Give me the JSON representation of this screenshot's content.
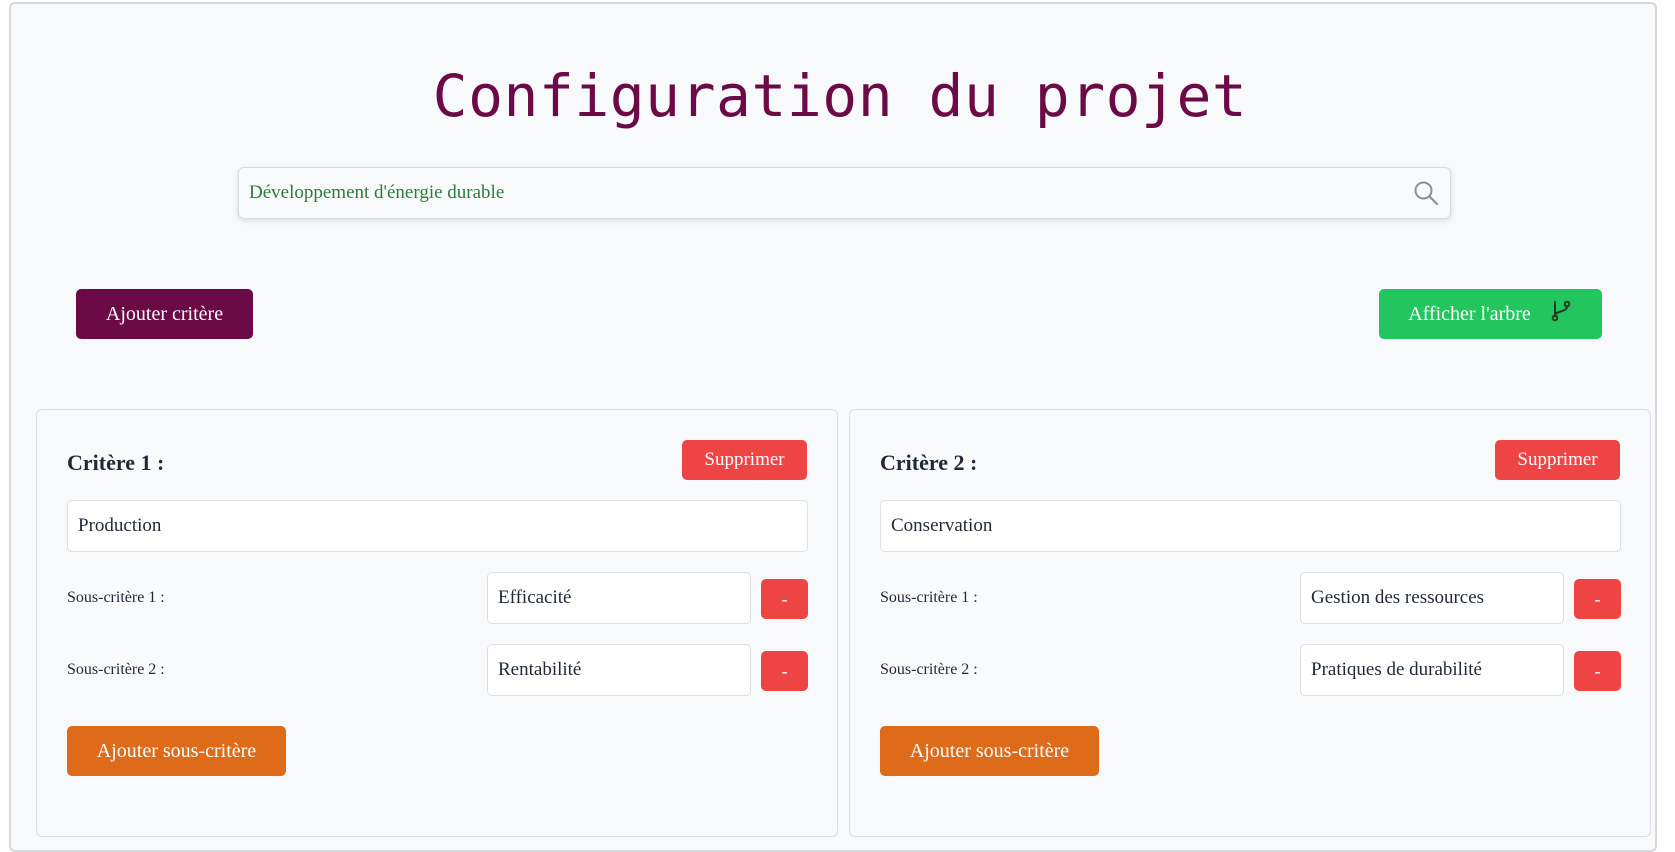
{
  "page": {
    "title": "Configuration du projet"
  },
  "project": {
    "name_value": "Développement d'énergie durable"
  },
  "toolbar": {
    "add_criterion_label": "Ajouter critère",
    "show_tree_label": "Afficher l'arbre"
  },
  "criteria": [
    {
      "title": "Critère 1 :",
      "delete_label": "Supprimer",
      "value": "Production",
      "subcriteria": [
        {
          "label": "Sous-critère 1 :",
          "value": "Efficacité",
          "remove_label": "-"
        },
        {
          "label": "Sous-critère 2 :",
          "value": "Rentabilité",
          "remove_label": "-"
        }
      ],
      "add_sub_label": "Ajouter sous-critère"
    },
    {
      "title": "Critère 2 :",
      "delete_label": "Supprimer",
      "value": "Conservation",
      "subcriteria": [
        {
          "label": "Sous-critère 1 :",
          "value": "Gestion des ressources",
          "remove_label": "-"
        },
        {
          "label": "Sous-critère 2 :",
          "value": "Pratiques de durabilité",
          "remove_label": "-"
        }
      ],
      "add_sub_label": "Ajouter sous-critère"
    }
  ],
  "colors": {
    "title": "#6b0a47",
    "primary": "#6b0a47",
    "success": "#22c55e",
    "danger": "#ef4444",
    "warning": "#de6b19",
    "project_text": "#2f7a3c"
  },
  "icons": {
    "search": "search-icon",
    "tree": "git-branch-icon"
  }
}
